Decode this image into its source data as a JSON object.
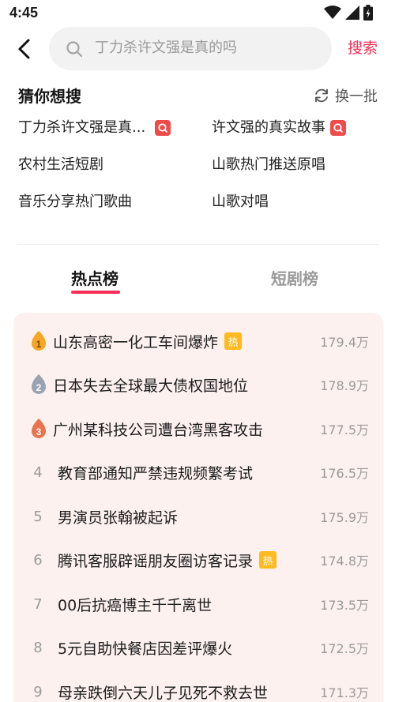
{
  "status_bar": {
    "time": "4:45"
  },
  "search": {
    "placeholder": "丁力杀许文强是真的吗",
    "button_label": "搜索"
  },
  "guess": {
    "title": "猜你想搜",
    "refresh_label": "换一批",
    "items": [
      {
        "label": "丁力杀许文强是真...",
        "badge": true
      },
      {
        "label": "许文强的真实故事",
        "badge": true
      },
      {
        "label": "农村生活短剧",
        "badge": false
      },
      {
        "label": "山歌热门推送原唱",
        "badge": false
      },
      {
        "label": "音乐分享热门歌曲",
        "badge": false
      },
      {
        "label": "山歌对唱",
        "badge": false
      }
    ]
  },
  "tabs": [
    {
      "label": "热点榜",
      "active": true
    },
    {
      "label": "短剧榜",
      "active": false
    }
  ],
  "hot_list": {
    "tag_label": "热",
    "items": [
      {
        "rank": "1",
        "title": "山东高密一化工车间爆炸",
        "count": "179.4万",
        "tag": true
      },
      {
        "rank": "2",
        "title": "日本失去全球最大债权国地位",
        "count": "178.9万",
        "tag": false
      },
      {
        "rank": "3",
        "title": "广州某科技公司遭台湾黑客攻击",
        "count": "177.5万",
        "tag": false
      },
      {
        "rank": "4",
        "title": "教育部通知严禁违规频繁考试",
        "count": "176.5万",
        "tag": false
      },
      {
        "rank": "5",
        "title": "男演员张翰被起诉",
        "count": "175.9万",
        "tag": false
      },
      {
        "rank": "6",
        "title": "腾讯客服辟谣朋友圈访客记录",
        "count": "174.8万",
        "tag": true
      },
      {
        "rank": "7",
        "title": "00后抗癌博主千千离世",
        "count": "173.5万",
        "tag": false
      },
      {
        "rank": "8",
        "title": "5元自助快餐店因差评爆火",
        "count": "172.5万",
        "tag": false
      },
      {
        "rank": "9",
        "title": "母亲跌倒六天儿子见死不救去世",
        "count": "171.3万",
        "tag": false
      }
    ]
  },
  "colors": {
    "accent": "#fe2c55",
    "card_bg": "#fdf1ef",
    "gold": "#f5a623",
    "silver": "#9aa3b2",
    "bronze": "#e8734f"
  }
}
